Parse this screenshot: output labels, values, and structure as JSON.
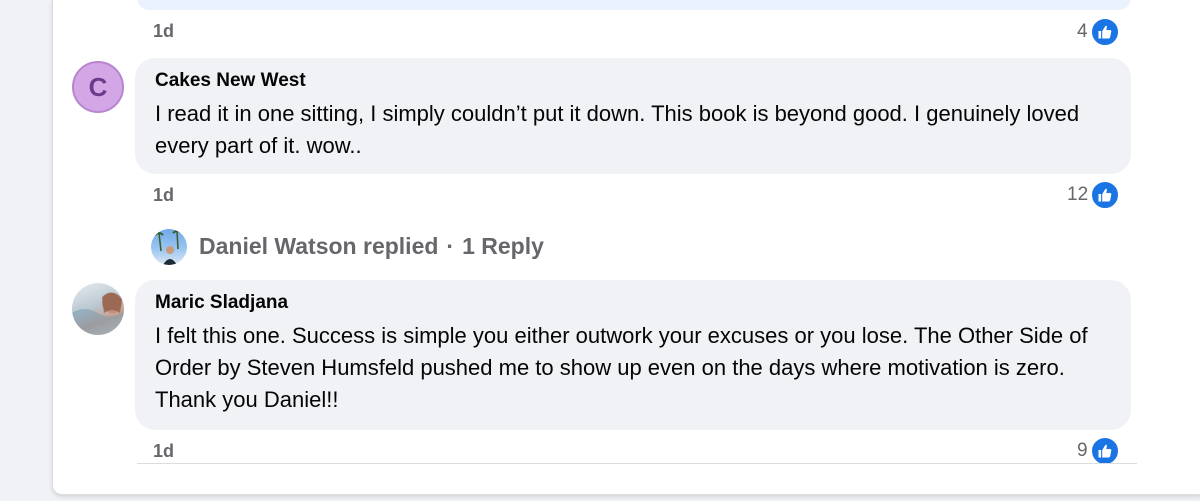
{
  "top_comment": {
    "time": "1d",
    "likes": "4"
  },
  "comments": [
    {
      "author": "Cakes New West",
      "avatar_letter": "C",
      "text": "I read it in one sitting, I simply couldn’t put it down. This book is beyond good. I genuinely loved every part of it. wow..",
      "time": "1d",
      "likes": "12"
    },
    {
      "author": "Maric Sladjana",
      "text": "I felt this one. Success is simple you either outwork your excuses or you lose. The Other Side of Order by Steven Humsfeld pushed me to show up even on the days where motivation is zero. Thank you Daniel!!",
      "time": "1d",
      "likes": "9"
    }
  ],
  "reply_summary": {
    "replier": "Daniel Watson replied",
    "separator": "·",
    "count": "1 Reply"
  },
  "colors": {
    "like_blue": "#1b74e4",
    "bubble_bg": "#f0f2f5",
    "secondary_text": "#65676b"
  },
  "icons": {
    "like": "thumbs-up-icon"
  }
}
